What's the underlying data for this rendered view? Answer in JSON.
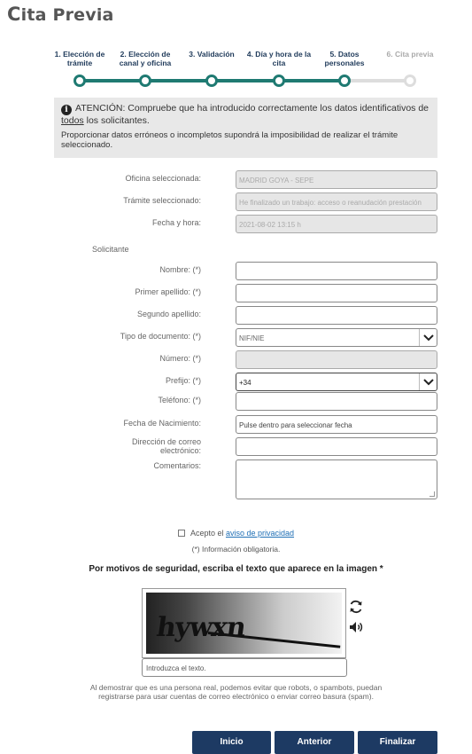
{
  "page": {
    "title_first": "C",
    "title_rest": "ita Previa"
  },
  "steps": [
    {
      "label": "1. Elección de trámite",
      "active": true
    },
    {
      "label": "2. Elección de canal y oficina",
      "active": true
    },
    {
      "label": "3. Validación",
      "active": true
    },
    {
      "label": "4. Día y hora de la cita",
      "active": true
    },
    {
      "label": "5. Datos personales",
      "active": true
    },
    {
      "label": "6. Cita previa",
      "active": false
    }
  ],
  "notice": {
    "icon": "info-icon",
    "line1_prefix": "ATENCIÓN: Compruebe que ha introducido correctamente los datos identificativos de ",
    "line1_link": "todos",
    "line1_suffix": " los solicitantes.",
    "line2": "Proporcionar datos erróneos o incompletos supondrá la imposibilidad de realizar el trámite seleccionado."
  },
  "summary": {
    "oficina_label": "Oficina seleccionada:",
    "oficina_value": "MADRID GOYA - SEPE",
    "tramite_label": "Trámite seleccionado:",
    "tramite_value": "He finalizado un trabajo: acceso o reanudación prestación",
    "fecha_label": "Fecha y hora:",
    "fecha_value": "2021-08-02 13:15 h"
  },
  "form": {
    "section": "Solicitante",
    "nombre_label": "Nombre: (*)",
    "apellido1_label": "Primer apellido: (*)",
    "apellido2_label": "Segundo apellido:",
    "tipodoc_label": "Tipo de documento: (*)",
    "tipodoc_value": "NIF/NIE",
    "numero_label": "Número: (*)",
    "prefijo_label": "Prefijo: (*)",
    "prefijo_value": "+34",
    "telefono_label": "Teléfono: (*)",
    "nacimiento_label": "Fecha de Nacimiento:",
    "nacimiento_placeholder": "Pulse dentro para seleccionar fecha",
    "email_label_1": "Dirección de correo",
    "email_label_2": "electrónico:",
    "comentarios_label": "Comentarios:"
  },
  "privacy": {
    "prefix": "Acepto el ",
    "link": "aviso de privacidad",
    "oblig": "(*) Información obligatoria."
  },
  "captcha": {
    "title": "Por motivos de seguridad, escriba el texto que aparece en la imagen *",
    "image_text": "hywxn",
    "refresh_icon": "refresh-icon",
    "audio_icon": "speaker-icon",
    "input_placeholder": "Introduzca el texto.",
    "note": "Al demostrar que es una persona real, podemos evitar que robots, o spambots, puedan registrarse para usar cuentas de correo electrónico o enviar correo basura (spam)."
  },
  "buttons": {
    "inicio": "Inicio",
    "anterior": "Anterior",
    "finalizar": "Finalizar"
  },
  "colors": {
    "accent": "#1f7a72",
    "button": "#1d3a63",
    "link": "#1f6fb5"
  }
}
